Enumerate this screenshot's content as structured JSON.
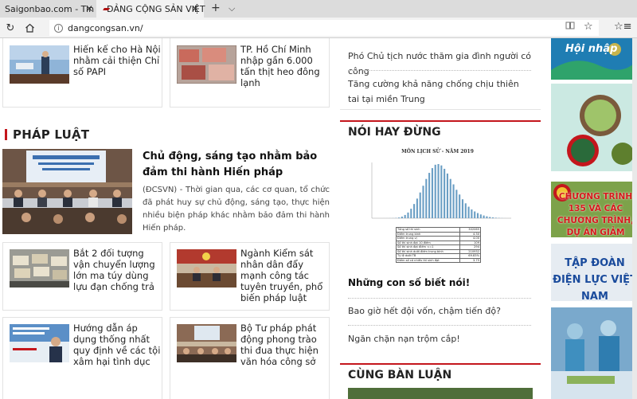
{
  "browser": {
    "tabs": [
      {
        "label": "Saigonbao.com - Tin tức Vie"
      },
      {
        "label": "ĐẢNG CỘNG SẢN VIỆT"
      }
    ],
    "url": "dangcongsan.vn/"
  },
  "top_cards": [
    {
      "title": "Hiến kế cho Hà Nội nhằm cải thiện Chỉ số PAPI"
    },
    {
      "title": "TP. Hồ Chí Minh nhập gần 6.000 tấn thịt heo đông lạnh"
    }
  ],
  "section": {
    "title": "PHÁP LUẬT"
  },
  "featured": {
    "title": "Chủ động, sáng tạo nhằm bảo đảm thi hành Hiến pháp",
    "description": "(ĐCSVN) - Thời gian qua, các cơ quan, tổ chức đã phát huy sự chủ động, sáng tạo, thực hiện nhiều biện pháp khác nhằm bảo đảm thi hành Hiến pháp."
  },
  "grid_cards": [
    {
      "title": "Bắt 2 đối tượng vận chuyển lượng lớn ma túy dùng lựu đạn chống trả"
    },
    {
      "title": "Ngành Kiểm sát nhân dân đẩy mạnh công tác tuyên truyền, phổ biến pháp luật"
    },
    {
      "title": "Hướng dẫn áp dụng thống nhất quy định về các tội xâm hại tình dục"
    },
    {
      "title": "Bộ Tư pháp phát động phong trào thi đua thực hiện văn hóa công sở"
    }
  ],
  "right_column": {
    "links_top": [
      {
        "text": "Phó Chủ tịch nước thăm gia đình người có công"
      },
      {
        "text": "Tăng cường khả năng chống chịu thiên tai tại miền Trung"
      }
    ],
    "noi_hay_dung": {
      "heading": "NÓI HAY ĐỪNG",
      "chart_title": "MÔN LỊCH SỬ - NĂM 2019",
      "featured_link": "Những con số biết nói!",
      "links": [
        {
          "text": "Bao giờ hết đội vốn, chậm tiến độ?"
        },
        {
          "text": "Ngăn chặn nạn trộm cắp!"
        }
      ]
    },
    "cung_ban_luan": {
      "heading": "CÙNG BÀN LUẬN"
    }
  },
  "ads": [
    {
      "text": "Hội nhập"
    },
    {
      "text": ""
    },
    {
      "text": "CHƯƠNG TRÌNH 135 VÀ CÁC CHƯƠNG TRÌNH, DỰ ÁN GIẢM NGHÈO"
    },
    {
      "text": "TẬP ĐOÀN ĐIỆN LỰC VIỆT NAM"
    },
    {
      "text": ""
    }
  ],
  "chart_data": {
    "type": "bar",
    "title": "MÔN LỊCH SỬ - NĂM 2019",
    "xlabel": "",
    "ylabel": "",
    "ylim": [
      0,
      40000
    ],
    "categories": [
      "0",
      "0.25",
      "0.5",
      "0.75",
      "1",
      "1.25",
      "1.5",
      "1.75",
      "2",
      "2.25",
      "2.5",
      "2.75",
      "3",
      "3.25",
      "3.5",
      "3.75",
      "4",
      "4.25",
      "4.5",
      "4.75",
      "5",
      "5.25",
      "5.5",
      "5.75",
      "6",
      "6.25",
      "6.5",
      "6.75",
      "7",
      "7.25",
      "7.5",
      "7.75",
      "8",
      "8.25",
      "8.5",
      "8.75",
      "9",
      "9.25",
      "9.5",
      "9.75",
      "10"
    ],
    "values": [
      10,
      20,
      40,
      80,
      200,
      500,
      1200,
      2400,
      4200,
      7000,
      10500,
      14500,
      19000,
      24000,
      29000,
      33500,
      37000,
      39500,
      40000,
      39000,
      36500,
      33000,
      29000,
      25000,
      21000,
      17500,
      14000,
      11000,
      8500,
      6500,
      5000,
      3800,
      2800,
      2000,
      1400,
      900,
      600,
      350,
      200,
      80,
      20
    ],
    "stats_rows": [
      {
        "label": "Tổng số thí sinh",
        "value": "302065"
      },
      {
        "label": "Điểm trung bình",
        "value": "4.30"
      },
      {
        "label": "Điểm trung vị",
        "value": "4.00"
      },
      {
        "label": "Số thí sinh đạt 10 điểm",
        "value": "109"
      },
      {
        "label": "Số thí sinh đạt điểm <=1",
        "value": "294"
      },
      {
        "label": "Số thí sinh dưới điểm trung bình",
        "value": "210932"
      },
      {
        "label": "Tỷ lệ dưới TB",
        "value": "69.83%"
      },
      {
        "label": "Điểm số có nhiều thí sinh đạt",
        "value": "3.75"
      }
    ]
  }
}
